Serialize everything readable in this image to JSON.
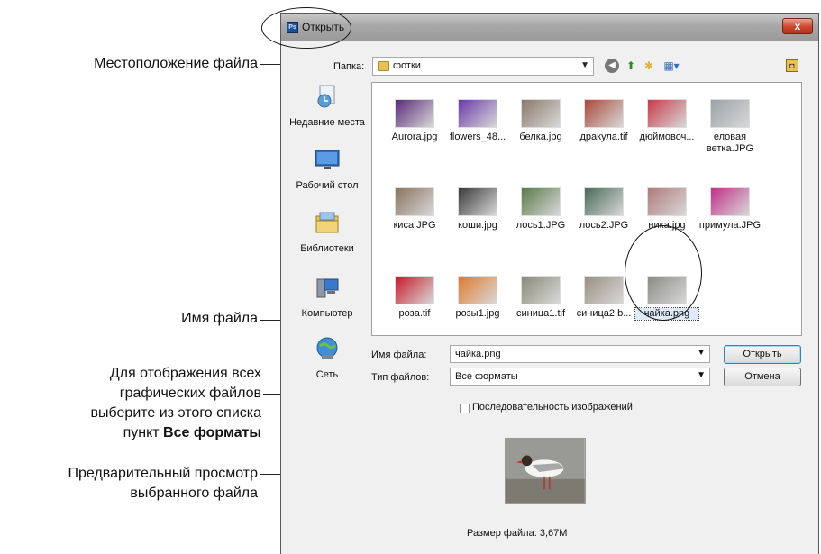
{
  "dialog": {
    "title": "Открыть",
    "app_badge": "Ps",
    "close_glyph": "x"
  },
  "toolbar": {
    "folder_label": "Папка:",
    "folder_value": "фотки",
    "icons": [
      "back-icon",
      "up-folder-icon",
      "new-folder-icon",
      "views-menu-icon",
      "extra-icon"
    ]
  },
  "places": [
    {
      "label": "Недавние места",
      "icon": "recent-places-icon"
    },
    {
      "label": "Рабочий стол",
      "icon": "desktop-icon"
    },
    {
      "label": "Библиотеки",
      "icon": "libraries-icon"
    },
    {
      "label": "Компьютер",
      "icon": "computer-icon"
    },
    {
      "label": "Сеть",
      "icon": "network-icon"
    }
  ],
  "files": [
    {
      "name": "Aurora.jpg",
      "color": "#5a2a7a"
    },
    {
      "name": "flowers_48...",
      "color": "#6a3aa8"
    },
    {
      "name": "белка.jpg",
      "color": "#8a7a6a"
    },
    {
      "name": "дракула.tif",
      "color": "#a84a3a"
    },
    {
      "name": "дюймовоч...",
      "color": "#c83a4a"
    },
    {
      "name": "еловая ветка.JPG",
      "color": "#9aa2a6"
    },
    {
      "name": "киса.JPG",
      "color": "#8a7460"
    },
    {
      "name": "коши.jpg",
      "color": "#3a3a3a"
    },
    {
      "name": "лось1.JPG",
      "color": "#5a7a4a"
    },
    {
      "name": "лось2.JPG",
      "color": "#4a6a5a"
    },
    {
      "name": "ника.jpg",
      "color": "#b07a7a"
    },
    {
      "name": "примула.JPG",
      "color": "#c0308a"
    },
    {
      "name": "роза.tif",
      "color": "#c81a2a"
    },
    {
      "name": "розы1.jpg",
      "color": "#e07a2a"
    },
    {
      "name": "синица1.tif",
      "color": "#8a8a7a"
    },
    {
      "name": "синица2.b...",
      "color": "#9a9080"
    },
    {
      "name": "чайка.png",
      "color": "#8a8a86",
      "selected": true
    }
  ],
  "form": {
    "filename_label": "Имя файла:",
    "filename_value": "чайка.png",
    "filetype_label": "Тип файлов:",
    "filetype_value": "Все форматы",
    "open_button": "Открыть",
    "cancel_button": "Отмена",
    "sequence_label": "Последовательность изображений",
    "sequence_checked": false
  },
  "preview": {
    "size_text": "Размер файла: 3,67М"
  },
  "callouts": {
    "location": "Местоположение файла",
    "filename": "Имя файла",
    "formats_line1": "Для отображения всех",
    "formats_line2": "графических файлов",
    "formats_line3": "выберите из этого списка",
    "formats_line4_plain": "пункт",
    "formats_line4_bold": "Все форматы",
    "preview_line1": "Предварительный просмотр",
    "preview_line2": "выбранного файла"
  }
}
